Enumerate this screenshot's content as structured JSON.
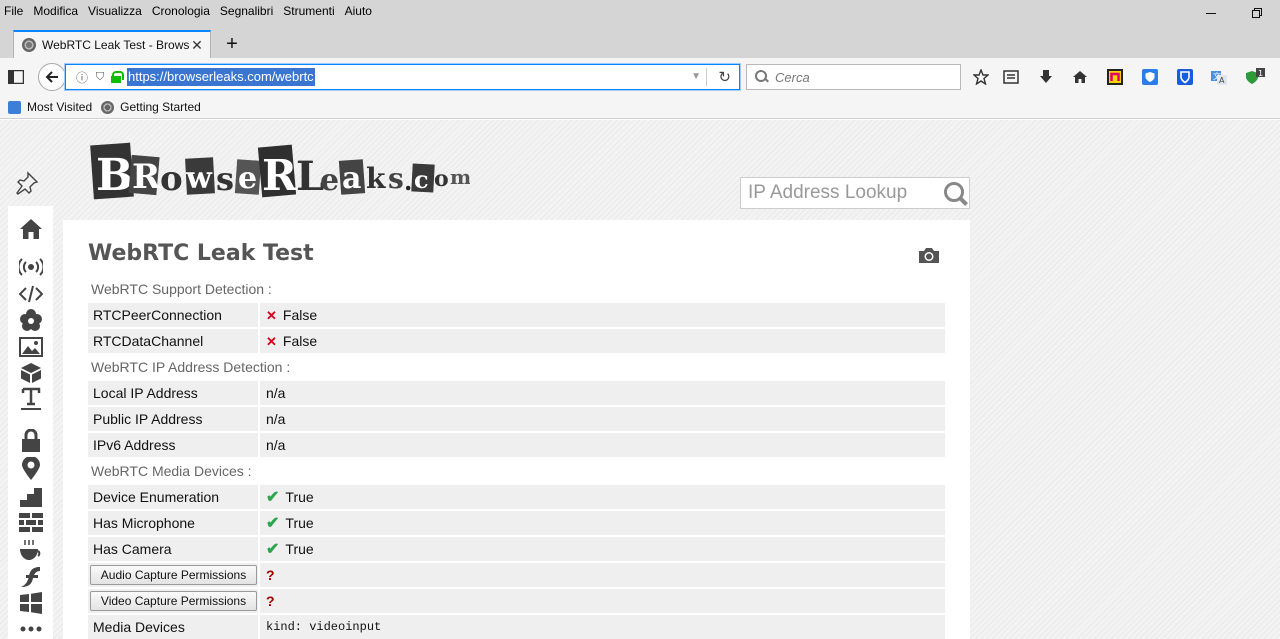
{
  "menubar": {
    "items": [
      "File",
      "Modifica",
      "Visualizza",
      "Cronologia",
      "Segnalibri",
      "Strumenti",
      "Aiuto"
    ]
  },
  "tab": {
    "title": "WebRTC Leak Test - BrowserL"
  },
  "urlbar": {
    "url": "https://browserleaks.com/webrtc"
  },
  "searchbar": {
    "placeholder": "Cerca"
  },
  "bookmarks": [
    {
      "label": "Most Visited"
    },
    {
      "label": "Getting Started"
    }
  ],
  "site": {
    "logo_text": "BRowseRLeaks.com",
    "lookup_placeholder": "IP Address Lookup"
  },
  "main": {
    "title": "WebRTC Leak Test",
    "sections": [
      {
        "heading": "WebRTC Support Detection :",
        "rows": [
          {
            "key": "RTCPeerConnection",
            "mark": "✕",
            "value": "False"
          },
          {
            "key": "RTCDataChannel",
            "mark": "✕",
            "value": "False"
          }
        ]
      },
      {
        "heading": "WebRTC IP Address Detection :",
        "rows": [
          {
            "key": "Local IP Address",
            "value": "n/a"
          },
          {
            "key": "Public IP Address",
            "value": "n/a"
          },
          {
            "key": "IPv6 Address",
            "value": "n/a"
          }
        ]
      },
      {
        "heading": "WebRTC Media Devices :",
        "rows": [
          {
            "key": "Device Enumeration",
            "mark": "✔",
            "value": "True"
          },
          {
            "key": "Has Microphone",
            "mark": "✔",
            "value": "True"
          },
          {
            "key": "Has Camera",
            "mark": "✔",
            "value": "True"
          }
        ],
        "permission_rows": [
          {
            "button": "Audio Capture Permissions",
            "value": "?"
          },
          {
            "button": "Video Capture Permissions",
            "value": "?"
          }
        ],
        "media_devices": {
          "key": "Media Devices",
          "value": "kind: videoinput"
        }
      }
    ]
  },
  "colors": {
    "accent": "#0a84ff",
    "false_mark": "#d6001c",
    "true_mark": "#2ea44f",
    "unknown_mark": "#a00000"
  }
}
